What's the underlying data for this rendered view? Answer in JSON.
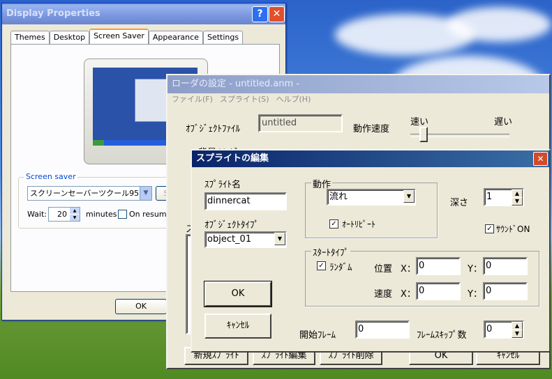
{
  "display_props": {
    "title": "Display Properties",
    "help_btn": "?",
    "close_btn": "✕",
    "tabs": [
      "Themes",
      "Desktop",
      "Screen Saver",
      "Appearance",
      "Settings"
    ],
    "screensaver_group": "Screen saver",
    "screensaver_value": "スクリーンセーバーツクール95",
    "settings_btn": "S",
    "wait_label": "Wait:",
    "wait_value": "20",
    "minutes": "minutes",
    "on_resume": "On resume,",
    "ok": "OK"
  },
  "loader": {
    "title": "ローダの設定 - untitled.anm -",
    "menu": [
      "ファイル(F)",
      "スプライト(S)",
      "ヘルプ(H)"
    ],
    "object_file_label": "ｵﾌﾞｼﾞｪｸﾄﾌｧｲﾙ",
    "object_file_value": "untitled",
    "speed_label": "動作速度",
    "speed_fast": "速い",
    "speed_slow": "遅い",
    "speed_value": 0.12,
    "bg_label": "背景ｲﾒｰｼﾞ",
    "list_label": "ス",
    "btn_new": "新規ｽﾌﾟﾗｲﾄ",
    "btn_edit": "ｽﾌﾟﾗｲﾄ編集",
    "btn_delete": "ｽﾌﾟﾗｲﾄ削除",
    "btn_ok": "OK",
    "btn_cancel": "ｷｬﾝｾﾙ"
  },
  "sprite": {
    "title": "スプライトの編集",
    "close_btn": "✕",
    "name_label": "ｽﾌﾟﾗｲﾄ名",
    "name_value": "dinnercat",
    "objtype_label": "ｵﾌﾞｼﾞｪｸﾄﾀｲﾌﾟ",
    "objtype_value": "object_01",
    "motion_group": "動作",
    "motion_value": "流れ",
    "autorepeat_label": "ｵｰﾄﾘﾋﾟｰﾄ",
    "autorepeat_checked": "✓",
    "depth_label": "深さ",
    "depth_value": "1",
    "sound_label": "ｻｳﾝﾄﾞON",
    "sound_checked": "✓",
    "start_group": "ｽﾀｰﾄﾀｲﾌﾟ",
    "random_label": "ﾗﾝﾀﾞﾑ",
    "random_checked": "✓",
    "pos_label": "位置",
    "speed_label": "速度",
    "x_label": "X：",
    "y_label": "Y：",
    "pos_x": "0",
    "pos_y": "0",
    "spd_x": "0",
    "spd_y": "0",
    "ok": "OK",
    "cancel": "ｷｬﾝｾﾙ",
    "start_frame_label": "開始ﾌﾚｰﾑ",
    "start_frame_value": "0",
    "frame_skip_label": "ﾌﾚｰﾑｽｷｯﾌﾟ数",
    "frame_skip_value": "0"
  }
}
